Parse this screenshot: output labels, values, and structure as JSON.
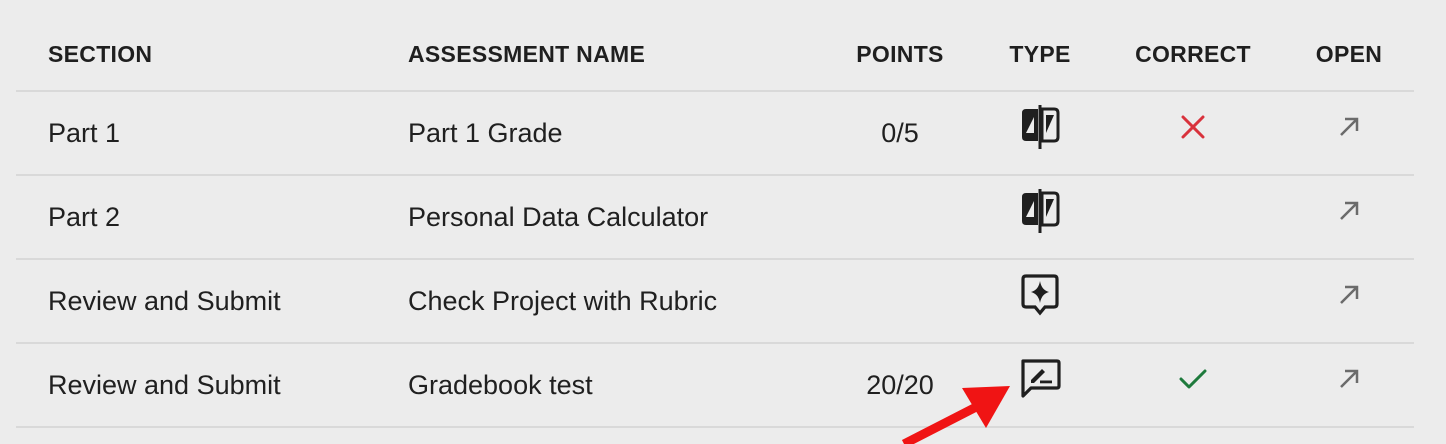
{
  "headers": {
    "section": "SECTION",
    "name": "ASSESSMENT NAME",
    "points": "POINTS",
    "type": "TYPE",
    "correct": "CORRECT",
    "open": "OPEN"
  },
  "rows": [
    {
      "section": "Part 1",
      "name": "Part 1 Grade",
      "points": "0/5",
      "type_icon": "code-compare-icon",
      "correct": "incorrect",
      "open_icon": "arrow-up-right-icon"
    },
    {
      "section": "Part 2",
      "name": "Personal Data Calculator",
      "points": "",
      "type_icon": "code-compare-icon",
      "correct": "",
      "open_icon": "arrow-up-right-icon"
    },
    {
      "section": "Review and Submit",
      "name": "Check Project with Rubric",
      "points": "",
      "type_icon": "sparkle-badge-icon",
      "correct": "",
      "open_icon": "arrow-up-right-icon"
    },
    {
      "section": "Review and Submit",
      "name": "Gradebook test",
      "points": "20/20",
      "type_icon": "chat-edit-icon",
      "correct": "correct",
      "open_icon": "arrow-up-right-icon"
    }
  ],
  "colors": {
    "incorrect": "#d9323c",
    "correct": "#1e7a3c",
    "annotation_arrow": "#f01414"
  }
}
